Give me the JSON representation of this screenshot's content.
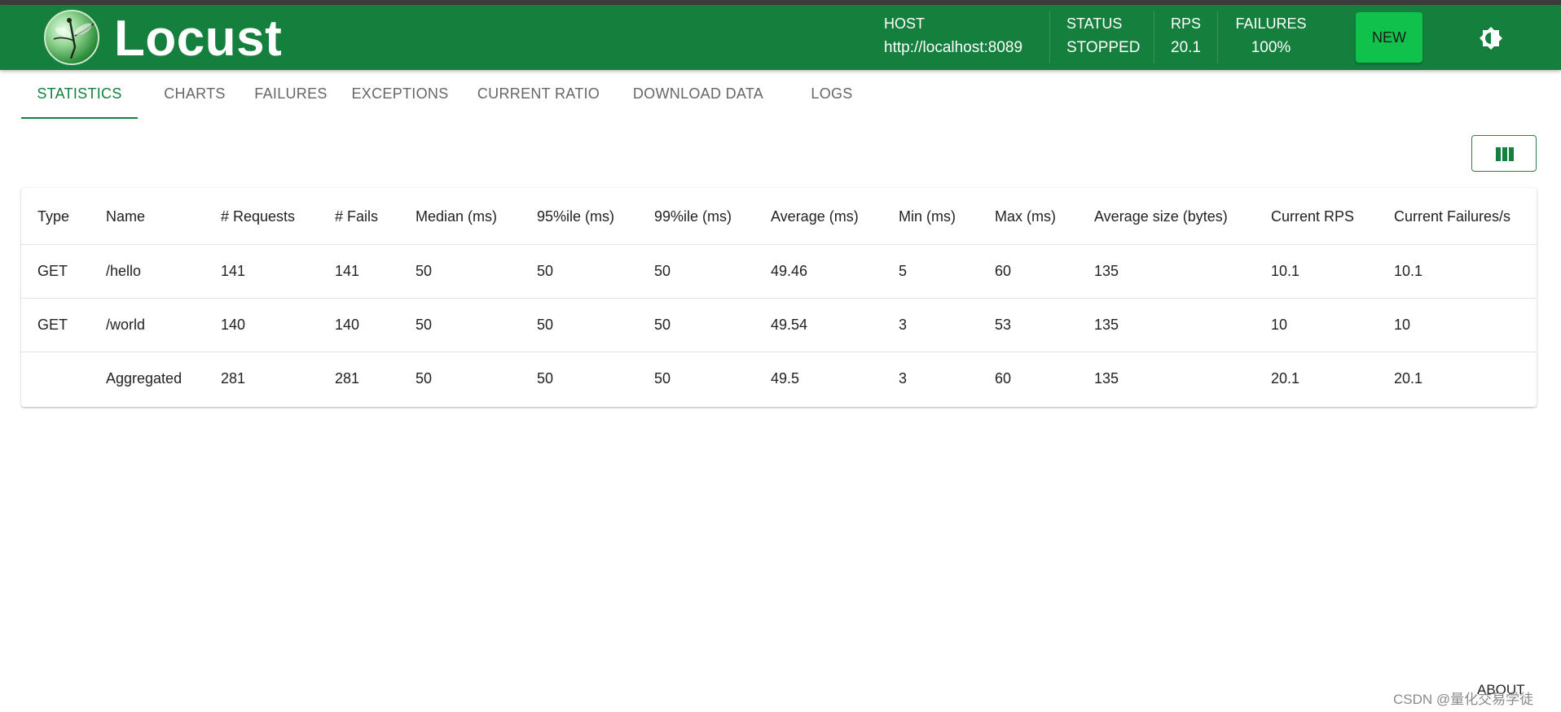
{
  "header": {
    "brand": "Locust",
    "host_label": "HOST",
    "host_value": "http://localhost:8089",
    "status_label": "STATUS",
    "status_value": "STOPPED",
    "rps_label": "RPS",
    "rps_value": "20.1",
    "failures_label": "FAILURES",
    "failures_value": "100%",
    "new_button": "NEW",
    "theme_icon": "brightness-icon"
  },
  "tabs": [
    {
      "label": "STATISTICS",
      "active": true
    },
    {
      "label": "CHARTS"
    },
    {
      "label": "FAILURES"
    },
    {
      "label": "EXCEPTIONS"
    },
    {
      "label": "CURRENT RATIO"
    },
    {
      "label": "DOWNLOAD DATA"
    },
    {
      "label": "LOGS"
    }
  ],
  "columns_button_icon": "view-columns-icon",
  "table": {
    "headers": [
      "Type",
      "Name",
      "# Requests",
      "# Fails",
      "Median (ms)",
      "95%ile (ms)",
      "99%ile (ms)",
      "Average (ms)",
      "Min (ms)",
      "Max (ms)",
      "Average size (bytes)",
      "Current RPS",
      "Current Failures/s"
    ],
    "rows": [
      [
        "GET",
        "/hello",
        "141",
        "141",
        "50",
        "50",
        "50",
        "49.46",
        "5",
        "60",
        "135",
        "10.1",
        "10.1"
      ],
      [
        "GET",
        "/world",
        "140",
        "140",
        "50",
        "50",
        "50",
        "49.54",
        "3",
        "53",
        "135",
        "10",
        "10"
      ],
      [
        "",
        "Aggregated",
        "281",
        "281",
        "50",
        "50",
        "50",
        "49.5",
        "3",
        "60",
        "135",
        "20.1",
        "20.1"
      ]
    ]
  },
  "footer": {
    "about": "ABOUT",
    "watermark": "CSDN @量化交易学徒"
  },
  "colors": {
    "brand_green": "#15803d",
    "new_button": "#10c24b",
    "top_strip": "#3b3b3b"
  }
}
